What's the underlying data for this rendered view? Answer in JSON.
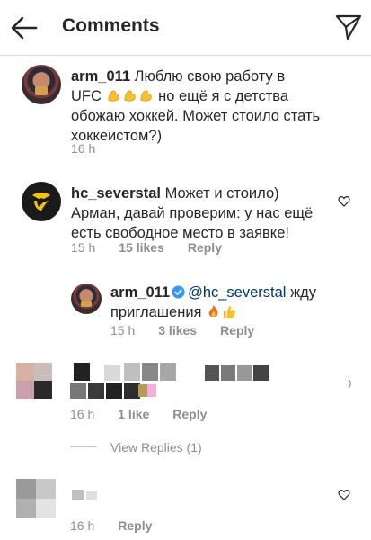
{
  "header": {
    "title": "Comments",
    "back_icon": "arrow-left-icon",
    "share_icon": "direct-share-icon"
  },
  "comments": [
    {
      "username": "arm_011",
      "text_l1": "Люблю свою работу в",
      "text_l2a": "UFC",
      "text_l2b": "но ещё я с детства",
      "text_l3": "обожаю хоккей. Может стоило стать",
      "text_l4": "хоккеистом?)",
      "emoji": "flexed-biceps-emoji",
      "time": "16 h"
    },
    {
      "username": "hc_severstal",
      "text_l1": "Может и стоило)",
      "text_l2": "Арман, давай проверим: у нас ещё",
      "text_l3": "есть свободное место в заявке!",
      "time": "15 h",
      "likes": "15 likes",
      "reply": "Reply"
    },
    {
      "username": "arm_011",
      "mention": "@hc_severstal",
      "text_l1": "жду",
      "text_l2": "приглашения",
      "emojis": [
        "fire-emoji",
        "thumbs-up-emoji"
      ],
      "time": "15 h",
      "likes": "3 likes",
      "reply": "Reply"
    },
    {
      "time": "16 h",
      "likes": "1 like",
      "reply": "Reply",
      "view_replies": "View Replies (1)"
    },
    {
      "time": "16 h",
      "reply": "Reply"
    }
  ],
  "colors": {
    "text": "#262626",
    "secondary": "#8e8e8e",
    "mention": "#003569",
    "verified": "#3897f0"
  }
}
